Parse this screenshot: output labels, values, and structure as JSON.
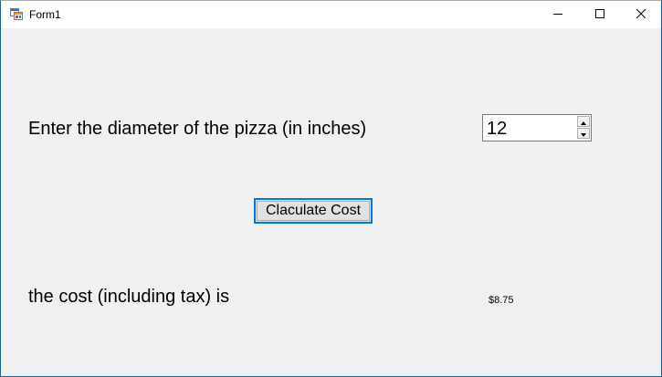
{
  "window": {
    "title": "Form1",
    "icon": "winforms-app-icon",
    "controls": {
      "minimize": "minimize-icon",
      "maximize": "maximize-icon",
      "close": "close-icon"
    },
    "accent_color": "#0078d7"
  },
  "form": {
    "diameter_label": "Enter the diameter of the pizza (in inches)",
    "diameter_value": "12",
    "calculate_button_label": "Claculate Cost",
    "cost_label": "the cost (including tax) is",
    "cost_value": "$8.75"
  }
}
